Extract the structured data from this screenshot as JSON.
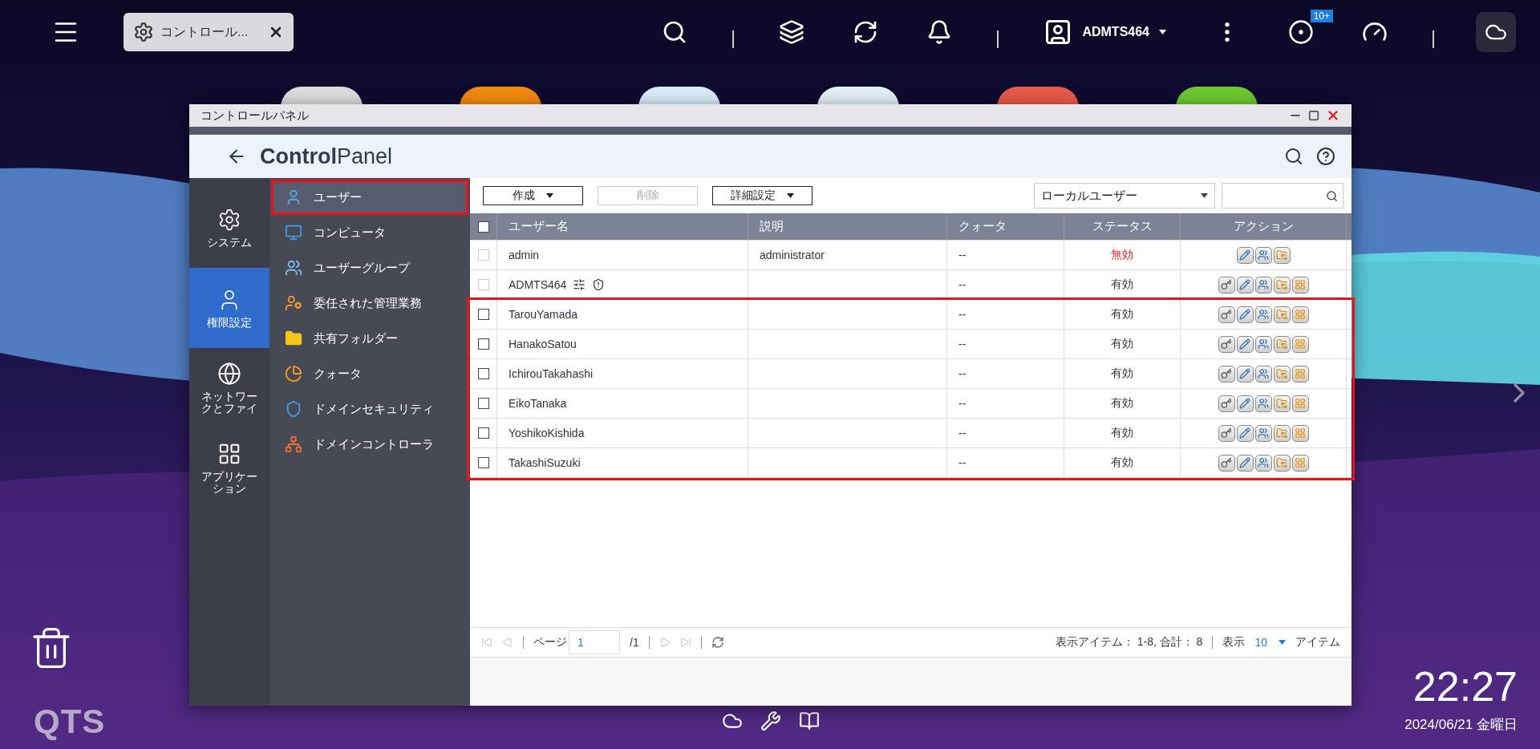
{
  "taskbar": {
    "tab": {
      "label": "コントロール...",
      "selected": true
    },
    "user": "ADMTS464",
    "notification_badge": "10+"
  },
  "desktop": {
    "trash": true,
    "logo": "QTS",
    "clock": {
      "time": "22:27",
      "date": "2024/06/21 金曜日"
    }
  },
  "window": {
    "title": "コントロールパネル",
    "header": "**Control**Panel",
    "nav": [
      {
        "label": "システム",
        "kind": "gear",
        "selected": false
      },
      {
        "label": "権限設定",
        "kind": "user",
        "selected": true
      },
      {
        "label": "ネットワークとファイ",
        "kind": "globe",
        "selected": false
      },
      {
        "label": "アプリケーション",
        "kind": "apps",
        "selected": false
      }
    ],
    "subnav": [
      {
        "label": "ユーザー",
        "kind": "user",
        "selected": true,
        "highlighted": true
      },
      {
        "label": "コンピュータ",
        "kind": "computer",
        "selected": false,
        "highlighted": false
      },
      {
        "label": "ユーザーグループ",
        "kind": "group",
        "selected": false,
        "highlighted": false
      },
      {
        "label": "委任された管理業務",
        "kind": "delegate",
        "selected": false,
        "highlighted": false
      },
      {
        "label": "共有フォルダー",
        "kind": "folder",
        "selected": false,
        "highlighted": false
      },
      {
        "label": "クォータ",
        "kind": "quota",
        "selected": false,
        "highlighted": false
      },
      {
        "label": "ドメインセキュリティ",
        "kind": "security",
        "selected": false,
        "highlighted": false
      },
      {
        "label": "ドメインコントローラ",
        "kind": "controller",
        "selected": false,
        "highlighted": false
      }
    ],
    "toolbar": {
      "buttons": [
        {
          "label": "作成",
          "dropdown": true,
          "disabled": false
        },
        {
          "label": "削除",
          "dropdown": false,
          "disabled": true
        },
        {
          "label": "詳細設定",
          "dropdown": true,
          "disabled": false
        }
      ],
      "filter": "ローカルユーザー"
    },
    "table": {
      "columns": [
        "ユーザー名",
        "説明",
        "クォータ",
        "ステータス",
        "アクション"
      ],
      "header_checked": false,
      "rows": [
        {
          "name": "admin",
          "badges": [],
          "description": "administrator",
          "quota": "--",
          "status": "無効",
          "enabled": false,
          "checked": false,
          "disabled": true,
          "highlighted": false,
          "actions": [
            {
              "kind": "edit"
            },
            {
              "kind": "group"
            },
            {
              "kind": "folder"
            }
          ]
        },
        {
          "name": "ADMTS464",
          "badges": [
            {
              "kind": "sliders"
            },
            {
              "kind": "shield"
            }
          ],
          "description": "",
          "quota": "--",
          "status": "有効",
          "enabled": true,
          "checked": false,
          "disabled": true,
          "highlighted": false,
          "actions": [
            {
              "kind": "key"
            },
            {
              "kind": "edit"
            },
            {
              "kind": "group"
            },
            {
              "kind": "folder"
            },
            {
              "kind": "apps"
            }
          ]
        },
        {
          "name": "TarouYamada",
          "badges": [],
          "description": "",
          "quota": "--",
          "status": "有効",
          "enabled": true,
          "checked": false,
          "disabled": false,
          "highlighted": true,
          "actions": [
            {
              "kind": "key"
            },
            {
              "kind": "edit"
            },
            {
              "kind": "group"
            },
            {
              "kind": "folder"
            },
            {
              "kind": "apps"
            }
          ]
        },
        {
          "name": "HanakoSatou",
          "badges": [],
          "description": "",
          "quota": "--",
          "status": "有効",
          "enabled": true,
          "checked": false,
          "disabled": false,
          "highlighted": true,
          "actions": [
            {
              "kind": "key"
            },
            {
              "kind": "edit"
            },
            {
              "kind": "group"
            },
            {
              "kind": "folder"
            },
            {
              "kind": "apps"
            }
          ]
        },
        {
          "name": "IchirouTakahashi",
          "badges": [],
          "description": "",
          "quota": "--",
          "status": "有効",
          "enabled": true,
          "checked": false,
          "disabled": false,
          "highlighted": true,
          "actions": [
            {
              "kind": "key"
            },
            {
              "kind": "edit"
            },
            {
              "kind": "group"
            },
            {
              "kind": "folder"
            },
            {
              "kind": "apps"
            }
          ]
        },
        {
          "name": "EikoTanaka",
          "badges": [],
          "description": "",
          "quota": "--",
          "status": "有効",
          "enabled": true,
          "checked": false,
          "disabled": false,
          "highlighted": true,
          "actions": [
            {
              "kind": "key"
            },
            {
              "kind": "edit"
            },
            {
              "kind": "group"
            },
            {
              "kind": "folder"
            },
            {
              "kind": "apps"
            }
          ]
        },
        {
          "name": "YoshikoKishida",
          "badges": [],
          "description": "",
          "quota": "--",
          "status": "有効",
          "enabled": true,
          "checked": false,
          "disabled": false,
          "highlighted": true,
          "actions": [
            {
              "kind": "key"
            },
            {
              "kind": "edit"
            },
            {
              "kind": "group"
            },
            {
              "kind": "folder"
            },
            {
              "kind": "apps"
            }
          ]
        },
        {
          "name": "TakashiSuzuki",
          "badges": [],
          "description": "",
          "quota": "--",
          "status": "有効",
          "enabled": true,
          "checked": false,
          "disabled": false,
          "highlighted": true,
          "actions": [
            {
              "kind": "key"
            },
            {
              "kind": "edit"
            },
            {
              "kind": "group"
            },
            {
              "kind": "folder"
            },
            {
              "kind": "apps"
            }
          ]
        }
      ]
    },
    "pager": {
      "page_label": "ページ",
      "page": "1",
      "total_pages": "/1",
      "summary": "表示アイテム： 1-8, 合計： 8",
      "show_label": "表示",
      "per_page": "10",
      "items_label": "アイテム"
    }
  }
}
